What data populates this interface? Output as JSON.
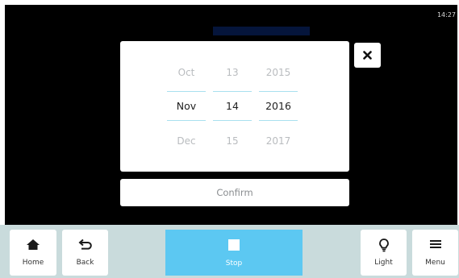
{
  "status_bar": {
    "time": "14:27"
  },
  "date_picker": {
    "month": {
      "prev": "Oct",
      "selected": "Nov",
      "next": "Dec"
    },
    "day": {
      "prev": "13",
      "selected": "14",
      "next": "15"
    },
    "year": {
      "prev": "2015",
      "selected": "2016",
      "next": "2017"
    }
  },
  "dialog": {
    "confirm_label": "Confirm",
    "close_icon": "close-icon"
  },
  "navbar": {
    "home": {
      "label": "Home",
      "icon": "home-icon"
    },
    "back": {
      "label": "Back",
      "icon": "back-arrow-icon"
    },
    "stop": {
      "label": "Stop",
      "icon": "stop-icon"
    },
    "light": {
      "label": "Light",
      "icon": "lightbulb-icon"
    },
    "menu": {
      "label": "Menu",
      "icon": "hamburger-menu-icon"
    }
  },
  "colors": {
    "screen_background": "#000000",
    "navbar_background": "#c9dbdc",
    "stop_button": "#5cc8f2",
    "selection_line": "#a8e0ef",
    "dim_text": "#b9bcbf"
  }
}
